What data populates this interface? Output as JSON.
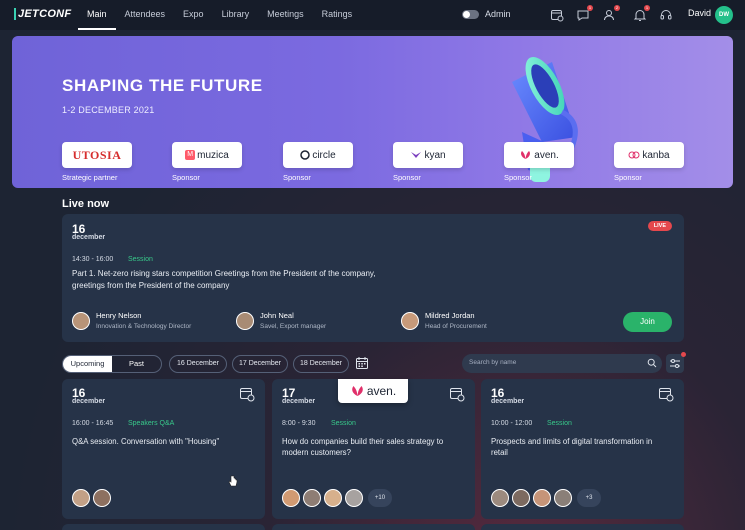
{
  "topbar": {
    "logo": "JETCONF",
    "nav": [
      "Main",
      "Attendees",
      "Expo",
      "Library",
      "Meetings",
      "Ratings"
    ],
    "admin_label": "Admin",
    "user_name": "David",
    "user_initials": "DW",
    "notif_counts": [
      "1",
      "2",
      "1"
    ]
  },
  "hero": {
    "title": "SHAPING THE FUTURE",
    "date": "1-2 DECEMBER 2021",
    "sponsors": [
      {
        "name": "UTOSIA",
        "caption": "Strategic partner"
      },
      {
        "name": "muzica",
        "caption": "Sponsor"
      },
      {
        "name": "circle",
        "caption": "Sponsor"
      },
      {
        "name": "kyan",
        "caption": "Sponsor"
      },
      {
        "name": "aven.",
        "caption": "Sponsor"
      },
      {
        "name": "kanba",
        "caption": "Sponsor"
      }
    ]
  },
  "live": {
    "section_title": "Live now",
    "day": "16",
    "month": "december",
    "badge": "LIVE",
    "time": "14:30 - 16:00",
    "type": "Session",
    "description_line1": "Part 1. Net-zero rising stars competition Greetings from the President of the company,",
    "description_line2": "greetings from the President of the company",
    "speakers": [
      {
        "name": "Henry Nelson",
        "role": "Innovation & Technology Director"
      },
      {
        "name": "John Neal",
        "role": "Savel, Export manager"
      },
      {
        "name": "Mildred Jordan",
        "role": "Head of Procurement"
      }
    ],
    "join_label": "Join"
  },
  "filters": {
    "upcoming": "Upcoming",
    "past": "Past",
    "dates": [
      "16 December",
      "17 December",
      "18 December"
    ],
    "search_placeholder": "Search by name"
  },
  "cards": [
    {
      "day": "16",
      "month": "december",
      "time": "16:00 - 16:45",
      "type": "Speakers Q&A",
      "title": "Q&A session. Conversation with \"Housing\"",
      "more": ""
    },
    {
      "day": "17",
      "month": "december",
      "time": "8:00 - 9:30",
      "type": "Session",
      "title": "How do companies build their sales strategy to modern customers?",
      "more": "+10"
    },
    {
      "day": "16",
      "month": "december",
      "time": "10:00 - 12:00",
      "type": "Session",
      "title": "Prospects and limits of digital transformation in retail",
      "more": "+3"
    }
  ],
  "popup_logo": "aven."
}
